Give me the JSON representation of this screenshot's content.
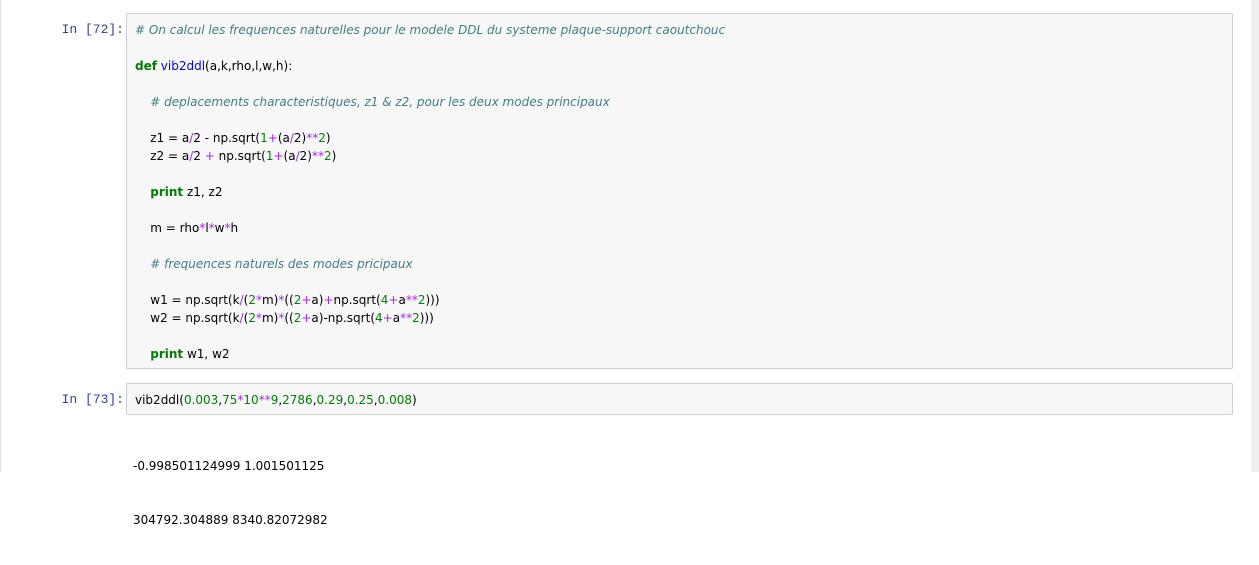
{
  "cells": [
    {
      "prompt": "In [72]:",
      "lines": [
        [
          {
            "t": "# On calcul les frequences naturelles pour le modele DDL du systeme plaque-support caoutchouc",
            "c": "comment"
          }
        ],
        [],
        [
          {
            "t": "def",
            "c": "kw"
          },
          {
            "t": " "
          },
          {
            "t": "vib2ddl",
            "c": "def"
          },
          {
            "t": "(a,k,rho,l,w,h):"
          }
        ],
        [],
        [
          {
            "t": "    "
          },
          {
            "t": "# deplacements characteristiques, z1 & z2, pour les deux modes principaux",
            "c": "comment"
          }
        ],
        [],
        [
          {
            "t": "    z1 = a"
          },
          {
            "t": "/",
            "c": "op"
          },
          {
            "t": "2 - np.sqrt("
          },
          {
            "t": "1",
            "c": "num"
          },
          {
            "t": "+",
            "c": "op"
          },
          {
            "t": "(a"
          },
          {
            "t": "/",
            "c": "op"
          },
          {
            "t": "2)"
          },
          {
            "t": "**",
            "c": "op"
          },
          {
            "t": "2",
            "c": "num"
          },
          {
            "t": ")"
          }
        ],
        [
          {
            "t": "    z2 = a"
          },
          {
            "t": "/",
            "c": "op"
          },
          {
            "t": "2 "
          },
          {
            "t": "+",
            "c": "op"
          },
          {
            "t": " np.sqrt("
          },
          {
            "t": "1",
            "c": "num"
          },
          {
            "t": "+",
            "c": "op"
          },
          {
            "t": "(a"
          },
          {
            "t": "/",
            "c": "op"
          },
          {
            "t": "2)"
          },
          {
            "t": "**",
            "c": "op"
          },
          {
            "t": "2",
            "c": "num"
          },
          {
            "t": ")"
          }
        ],
        [],
        [
          {
            "t": "    "
          },
          {
            "t": "print",
            "c": "kw"
          },
          {
            "t": " z1, z2"
          }
        ],
        [],
        [
          {
            "t": "    m = rho"
          },
          {
            "t": "*",
            "c": "op"
          },
          {
            "t": "l"
          },
          {
            "t": "*",
            "c": "op"
          },
          {
            "t": "w"
          },
          {
            "t": "*",
            "c": "op"
          },
          {
            "t": "h"
          }
        ],
        [],
        [
          {
            "t": "    "
          },
          {
            "t": "# frequences naturels des modes pricipaux",
            "c": "comment"
          }
        ],
        [],
        [
          {
            "t": "    w1 = np.sqrt(k"
          },
          {
            "t": "/",
            "c": "op"
          },
          {
            "t": "("
          },
          {
            "t": "2",
            "c": "num"
          },
          {
            "t": "*",
            "c": "op"
          },
          {
            "t": "m)"
          },
          {
            "t": "*",
            "c": "op"
          },
          {
            "t": "(("
          },
          {
            "t": "2",
            "c": "num"
          },
          {
            "t": "+",
            "c": "op"
          },
          {
            "t": "a)"
          },
          {
            "t": "+",
            "c": "op"
          },
          {
            "t": "np.sqrt("
          },
          {
            "t": "4",
            "c": "num"
          },
          {
            "t": "+",
            "c": "op"
          },
          {
            "t": "a"
          },
          {
            "t": "**",
            "c": "op"
          },
          {
            "t": "2",
            "c": "num"
          },
          {
            "t": ")))"
          }
        ],
        [
          {
            "t": "    w2 = np.sqrt(k"
          },
          {
            "t": "/",
            "c": "op"
          },
          {
            "t": "("
          },
          {
            "t": "2",
            "c": "num"
          },
          {
            "t": "*",
            "c": "op"
          },
          {
            "t": "m)"
          },
          {
            "t": "*",
            "c": "op"
          },
          {
            "t": "(("
          },
          {
            "t": "2",
            "c": "num"
          },
          {
            "t": "+",
            "c": "op"
          },
          {
            "t": "a)-np.sqrt("
          },
          {
            "t": "4",
            "c": "num"
          },
          {
            "t": "+",
            "c": "op"
          },
          {
            "t": "a"
          },
          {
            "t": "**",
            "c": "op"
          },
          {
            "t": "2",
            "c": "num"
          },
          {
            "t": ")))"
          }
        ],
        [],
        [
          {
            "t": "    "
          },
          {
            "t": "print",
            "c": "kw"
          },
          {
            "t": " w1, w2"
          }
        ]
      ]
    },
    {
      "prompt": "In [73]:",
      "lines": [
        [
          {
            "t": "vib2ddl("
          },
          {
            "t": "0.003",
            "c": "num"
          },
          {
            "t": ","
          },
          {
            "t": "75",
            "c": "num"
          },
          {
            "t": "*",
            "c": "op"
          },
          {
            "t": "10",
            "c": "num"
          },
          {
            "t": "**",
            "c": "op"
          },
          {
            "t": "9",
            "c": "num"
          },
          {
            "t": ","
          },
          {
            "t": "2786",
            "c": "num"
          },
          {
            "t": ","
          },
          {
            "t": "0.29",
            "c": "num"
          },
          {
            "t": ","
          },
          {
            "t": "0.25",
            "c": "num"
          },
          {
            "t": ","
          },
          {
            "t": "0.008",
            "c": "num"
          },
          {
            "t": ")"
          }
        ]
      ],
      "output": [
        "-0.998501124999 1.001501125",
        "304792.304889 8340.82072982"
      ]
    }
  ]
}
